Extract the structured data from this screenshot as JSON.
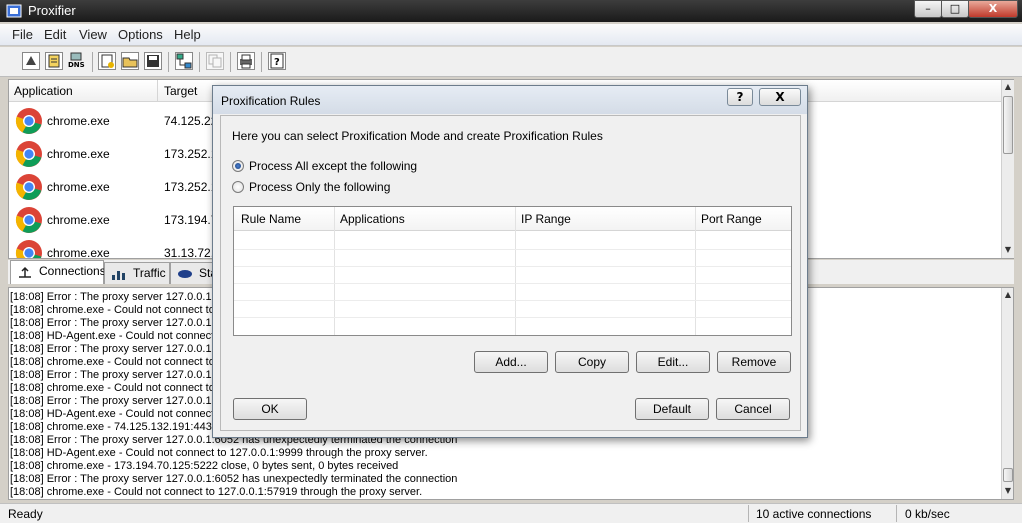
{
  "window": {
    "title": "Proxifier",
    "min": "–",
    "max": "□",
    "close": "X"
  },
  "menu": [
    "File",
    "Edit",
    "View",
    "Options",
    "Help"
  ],
  "list": {
    "columns": [
      "Application",
      "Target"
    ],
    "rows": [
      {
        "app": "chrome.exe",
        "target": "74.125.22"
      },
      {
        "app": "chrome.exe",
        "target": "173.252.1"
      },
      {
        "app": "chrome.exe",
        "target": "173.252.1"
      },
      {
        "app": "chrome.exe",
        "target": "173.194.7"
      },
      {
        "app": "chrome.exe",
        "target": "31.13.72.8"
      }
    ]
  },
  "tabs": [
    "Connections",
    "Traffic",
    "Sta"
  ],
  "log": [
    "[18:08] Error : The proxy server 127.0.0.1:6",
    "[18:08] chrome.exe - Could not connect to",
    "[18:08] Error : The proxy server 127.0.0.1:6",
    "[18:08] HD-Agent.exe - Could not connect",
    "[18:08] Error : The proxy server 127.0.0.1:6",
    "[18:08] chrome.exe - Could not connect to",
    "[18:08] Error : The proxy server 127.0.0.1:6",
    "[18:08] chrome.exe - Could not connect to",
    "[18:08] Error : The proxy server 127.0.0.1:6",
    "[18:08] HD-Agent.exe - Could not connect",
    "[18:08] chrome.exe - 74.125.132.191:443 c",
    "[18:08] Error : The proxy server 127.0.0.1:6052 has unexpectedly terminated the connection",
    "[18:08] HD-Agent.exe - Could not connect to 127.0.0.1:9999 through the proxy server.",
    "[18:08] chrome.exe - 173.194.70.125:5222 close, 0 bytes sent, 0 bytes received",
    "[18:08] Error : The proxy server 127.0.0.1:6052 has unexpectedly terminated the connection",
    "[18:08] chrome.exe - Could not connect to 127.0.0.1:57919 through the proxy server."
  ],
  "status": {
    "ready": "Ready",
    "connections": "10 active connections",
    "speed": "0 kb/sec"
  },
  "dialog": {
    "title": "Proxification Rules",
    "help": "?",
    "close": "X",
    "intro": "Here you can select Proxification Mode and create Proxification Rules",
    "mode_all": "Process All except the following",
    "mode_only": "Process Only the following",
    "selected_mode": "all",
    "columns": [
      "Rule Name",
      "Applications",
      "IP Range",
      "Port Range"
    ],
    "buttons": {
      "add": "Add...",
      "copy": "Copy",
      "edit": "Edit...",
      "remove": "Remove",
      "ok": "OK",
      "default": "Default",
      "cancel": "Cancel"
    }
  }
}
